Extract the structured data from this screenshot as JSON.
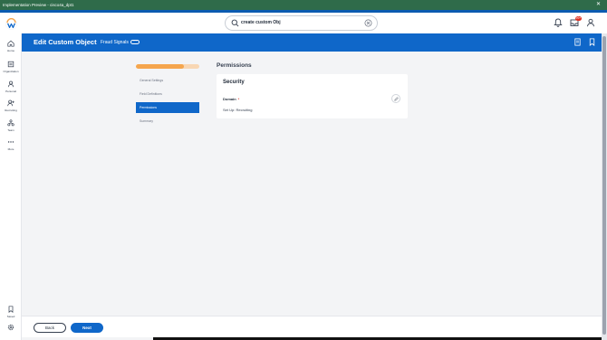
{
  "window": {
    "title": "Implementation Preview - cisco4a_dpt1",
    "close_symbol": "✕"
  },
  "search": {
    "value": "create custom Obj"
  },
  "notifications": {
    "inbox_count": "99+"
  },
  "sidebar": {
    "items": [
      {
        "label": "Home",
        "icon": "home-icon"
      },
      {
        "label": "Organization",
        "icon": "organization-icon"
      },
      {
        "label": "Personal",
        "icon": "person-icon"
      },
      {
        "label": "Recruiting",
        "icon": "recruiting-icon"
      },
      {
        "label": "Team",
        "icon": "team-icon"
      },
      {
        "label": "More",
        "icon": "more-icon"
      },
      {
        "label": "Saved",
        "icon": "bookmark-icon"
      }
    ]
  },
  "header": {
    "title": "Edit Custom Object",
    "subtitle": "Fraud Signals",
    "more_label": "···"
  },
  "wizard": {
    "progress_fraction": 0.75,
    "steps": [
      {
        "label": "General Settings",
        "active": false
      },
      {
        "label": "Field Definitions",
        "active": false
      },
      {
        "label": "Permissions",
        "active": true
      },
      {
        "label": "Summary",
        "active": false
      }
    ]
  },
  "main": {
    "page_title": "Permissions",
    "section_title": "Security",
    "field_label": "Domain",
    "required_marker": "*",
    "field_value": "Set Up: Recruiting"
  },
  "footer": {
    "back_label": "Back",
    "next_label": "Next"
  },
  "colors": {
    "brand_blue": "#0f67c9",
    "progress_orange": "#f5a64e",
    "env_green": "#2f6b4a",
    "badge_red": "#de2e21"
  }
}
